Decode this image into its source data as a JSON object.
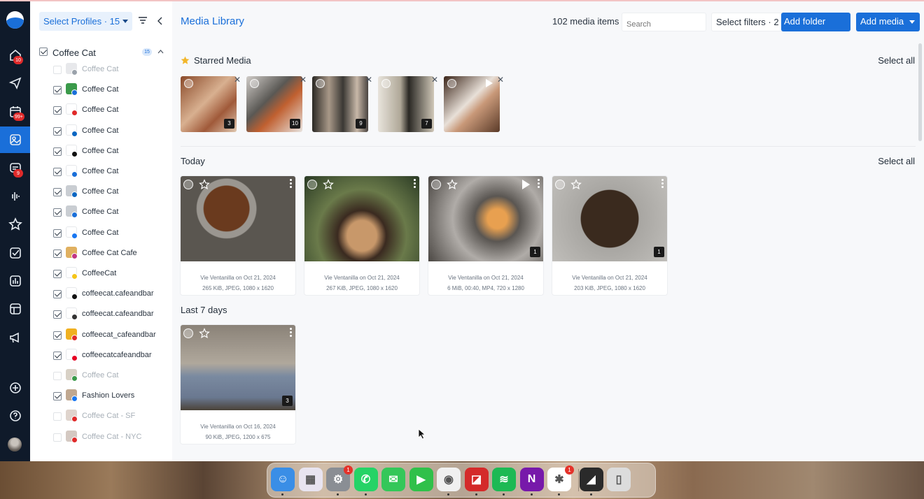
{
  "rail": {
    "badges": {
      "home": "10",
      "calendar": "99+",
      "inbox": "9"
    }
  },
  "profiles": {
    "select_label": "Select Profiles · 15",
    "group": {
      "label": "Coffee Cat",
      "count": "15"
    },
    "items": [
      {
        "label": "Coffee Cat",
        "checked": false,
        "disabled": true,
        "avatar": "#c9cdd2",
        "net": "#9aa2ab"
      },
      {
        "label": "Coffee Cat",
        "checked": true,
        "disabled": false,
        "avatar": "#3a9a4a",
        "net": "#1a6fd9"
      },
      {
        "label": "Coffee Cat",
        "checked": true,
        "disabled": false,
        "avatar": "#ffffff",
        "net": "#e02a2a"
      },
      {
        "label": "Coffee Cat",
        "checked": true,
        "disabled": false,
        "avatar": "#ffffff",
        "net": "#0a66c2"
      },
      {
        "label": "Coffee Cat",
        "checked": true,
        "disabled": false,
        "avatar": "#ffffff",
        "net": "#111111"
      },
      {
        "label": "Coffee Cat",
        "checked": true,
        "disabled": false,
        "avatar": "#ffffff",
        "net": "#1a6fd9"
      },
      {
        "label": "Coffee Cat",
        "checked": true,
        "disabled": false,
        "avatar": "#c9cdd2",
        "net": "#0a66c2"
      },
      {
        "label": "Coffee Cat",
        "checked": true,
        "disabled": false,
        "avatar": "#c9cdd2",
        "net": "#1a6fd9"
      },
      {
        "label": "Coffee Cat",
        "checked": true,
        "disabled": false,
        "avatar": "#ffffff",
        "net": "#1877f2"
      },
      {
        "label": "Coffee Cat Cafe",
        "checked": true,
        "disabled": false,
        "avatar": "#e0b060",
        "net": "#c13584"
      },
      {
        "label": "CoffeeCat",
        "checked": true,
        "disabled": false,
        "avatar": "#ffffff",
        "net": "#f5c518"
      },
      {
        "label": "coffeecat.cafeandbar",
        "checked": true,
        "disabled": false,
        "avatar": "#ffffff",
        "net": "#111111"
      },
      {
        "label": "coffeecat.cafeandbar",
        "checked": true,
        "disabled": false,
        "avatar": "#ffffff",
        "net": "#333333"
      },
      {
        "label": "coffeecat_cafeandbar",
        "checked": true,
        "disabled": false,
        "avatar": "#f0b020",
        "net": "#e02a2a"
      },
      {
        "label": "coffeecatcafeandbar",
        "checked": true,
        "disabled": false,
        "avatar": "#ffffff",
        "net": "#e60023"
      },
      {
        "label": "Coffee Cat",
        "checked": false,
        "disabled": true,
        "avatar": "#a89880",
        "net": "#3a9a4a"
      },
      {
        "label": "Fashion Lovers",
        "checked": true,
        "disabled": false,
        "avatar": "#c0a890",
        "net": "#1877f2"
      },
      {
        "label": "Coffee Cat - SF",
        "checked": false,
        "disabled": true,
        "avatar": "#b8a090",
        "net": "#e02a2a"
      },
      {
        "label": "Coffee Cat - NYC",
        "checked": false,
        "disabled": true,
        "avatar": "#a08878",
        "net": "#e02a2a"
      }
    ]
  },
  "header": {
    "title": "Media Library",
    "count": "102 media items",
    "search_placeholder": "Search",
    "filters_label": "Select filters · 2",
    "add_folder": "Add folder",
    "add_media": "Add media"
  },
  "starred": {
    "title": "Starred Media",
    "select_all": "Select all",
    "items": [
      {
        "count": "3",
        "bg": "linear-gradient(135deg,#8a4a2a,#d8b090 45%,#a05a3a 70%,#e0c8b0)"
      },
      {
        "count": "10",
        "bg": "linear-gradient(135deg,#d0ccc8,#5a5854 40%,#c06030 60%,#e8e4e0)"
      },
      {
        "count": "9",
        "bg": "linear-gradient(90deg,#2a2824,#a89888 30%,#3a3834 55%,#c8b8a8 80%,#4a4440)"
      },
      {
        "count": "7",
        "bg": "linear-gradient(90deg,#e8e4dc,#b0a898 40%,#2a2824 55%,#d0c8b8)"
      },
      {
        "count": "",
        "bg": "linear-gradient(135deg,#3a2418,#e8e0d8 45%,#c89878 60%,#5a3a28)",
        "video": true
      }
    ]
  },
  "today": {
    "title": "Today",
    "select_all": "Select all",
    "cards": [
      {
        "meta1": "Vie Ventanilla on Oct 21, 2024",
        "meta2": "265 KiB, JPEG, 1080 x 1620",
        "count": "",
        "bg": "radial-gradient(circle at 40% 38%, #6a3a1e 0 26%, #9a9690 27% 34%, #5a5650 35% 100%)"
      },
      {
        "meta1": "Vie Ventanilla on Oct 21, 2024",
        "meta2": "267 KiB, JPEG, 1080 x 1620",
        "count": "",
        "bg": "radial-gradient(ellipse at 50% 70%, #c8986a 0 18%, #3a2a20 30%, #6a7a4a 55%, #2a3a24 100%)"
      },
      {
        "meta1": "Vie Ventanilla on Oct 21, 2024",
        "meta2": "6 MiB, 00:40, MP4, 720 x 1280",
        "count": "1",
        "bg": "radial-gradient(circle at 60% 50%, #e8a050 0 12%, #5a5652 28%, #b0aca8 55%, #4a4642 100%)",
        "video": true
      },
      {
        "meta1": "Vie Ventanilla on Oct 21, 2024",
        "meta2": "203 KiB, JPEG, 1080 x 1620",
        "count": "1",
        "bg": "radial-gradient(circle at 50% 50%, #3a2a1e 0 40%, #a8a6a2 41%, #c0beba 100%)"
      }
    ]
  },
  "last7": {
    "title": "Last 7 days",
    "cards": [
      {
        "meta1": "Vie Ventanilla on Oct 16, 2024",
        "meta2": "90 KiB, JPEG, 1200 x 675",
        "count": "3",
        "bg": "linear-gradient(180deg,#8a8278 0%,#b0a89c 45%,#7a8aa0 60%,#6a7890 85%,#4a4238 100%)"
      }
    ]
  },
  "dock": {
    "apps": [
      {
        "name": "finder-icon",
        "color": "#3a8ee6",
        "glyph": "☺",
        "badge": "",
        "dot": true
      },
      {
        "name": "launchpad-icon",
        "color": "#e8e4f0",
        "glyph": "▦",
        "badge": "",
        "dot": false
      },
      {
        "name": "settings-icon",
        "color": "#8a8e94",
        "glyph": "⚙",
        "badge": "1",
        "dot": true
      },
      {
        "name": "whatsapp-icon",
        "color": "#25d366",
        "glyph": "✆",
        "badge": "",
        "dot": true
      },
      {
        "name": "messages-icon",
        "color": "#34c759",
        "glyph": "✉",
        "badge": "",
        "dot": false
      },
      {
        "name": "facetime-icon",
        "color": "#30c04a",
        "glyph": "▶",
        "badge": "",
        "dot": false
      },
      {
        "name": "chrome-icon",
        "color": "#f0f0f0",
        "glyph": "◉",
        "badge": "",
        "dot": true
      },
      {
        "name": "onedrive-app-icon",
        "color": "#d42a2a",
        "glyph": "◪",
        "badge": "",
        "dot": true
      },
      {
        "name": "spotify-icon",
        "color": "#1db954",
        "glyph": "≋",
        "badge": "",
        "dot": true
      },
      {
        "name": "onenote-icon",
        "color": "#7719aa",
        "glyph": "N",
        "badge": "",
        "dot": true
      },
      {
        "name": "slack-icon",
        "color": "#ffffff",
        "glyph": "✱",
        "badge": "1",
        "dot": true
      },
      {
        "name": "creative-app-icon",
        "color": "#2a2a2a",
        "glyph": "◢",
        "badge": "",
        "dot": true
      },
      {
        "name": "trash-icon",
        "color": "#dcdcdc",
        "glyph": "▯",
        "badge": "",
        "dot": false
      }
    ]
  }
}
